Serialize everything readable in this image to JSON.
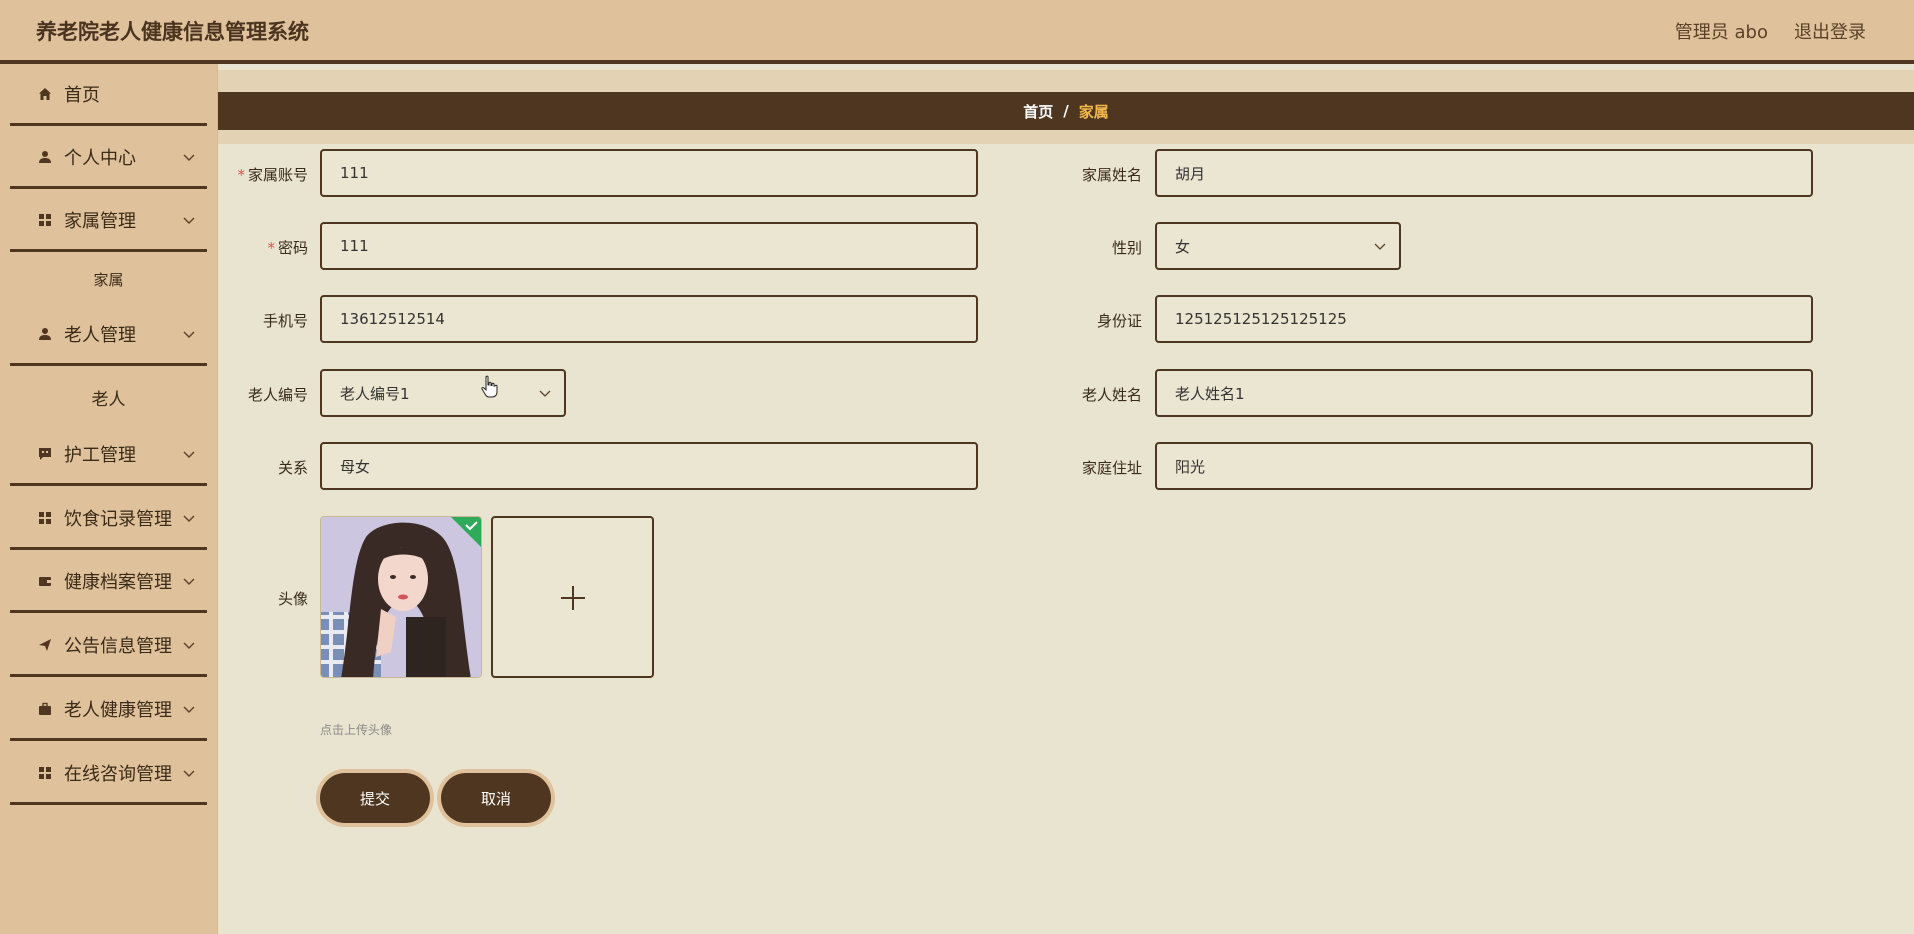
{
  "header": {
    "app_title": "养老院老人健康信息管理系统",
    "user_label": "管理员 abo",
    "logout_label": "退出登录"
  },
  "sidebar": {
    "items": [
      {
        "label": "首页",
        "icon": "home-icon"
      },
      {
        "label": "个人中心",
        "icon": "user-icon"
      },
      {
        "label": "家属管理",
        "icon": "grid-icon"
      },
      {
        "label": "老人管理",
        "icon": "user-icon"
      },
      {
        "label": "护工管理",
        "icon": "chat-icon"
      },
      {
        "label": "饮食记录管理",
        "icon": "grid-icon"
      },
      {
        "label": "健康档案管理",
        "icon": "wallet-icon"
      },
      {
        "label": "公告信息管理",
        "icon": "send-icon"
      },
      {
        "label": "老人健康管理",
        "icon": "briefcase-icon"
      },
      {
        "label": "在线咨询管理",
        "icon": "grid-icon"
      }
    ],
    "subitems": {
      "family": "家属",
      "elder": "老人"
    }
  },
  "breadcrumb": {
    "home": "首页",
    "separator": "/",
    "current": "家属"
  },
  "form": {
    "account": {
      "label": "家属账号",
      "value": "111",
      "required": true
    },
    "name": {
      "label": "家属姓名",
      "value": "胡月"
    },
    "password": {
      "label": "密码",
      "value": "111",
      "required": true
    },
    "gender": {
      "label": "性别",
      "value": "女"
    },
    "phone": {
      "label": "手机号",
      "value": "13612512514"
    },
    "id_card": {
      "label": "身份证",
      "value": "125125125125125125"
    },
    "elder_no": {
      "label": "老人编号",
      "value": "老人编号1"
    },
    "elder_name": {
      "label": "老人姓名",
      "value": "老人姓名1"
    },
    "relation": {
      "label": "关系",
      "value": "母女"
    },
    "address": {
      "label": "家庭住址",
      "value": "阳光"
    },
    "avatar": {
      "label": "头像",
      "hint": "点击上传头像"
    },
    "submit_label": "提交",
    "cancel_label": "取消"
  },
  "colors": {
    "header_bg": "#dfc19b",
    "dark_brown": "#4e3620",
    "page_bg": "#e8e4d0",
    "crumb_current": "#f2b94a",
    "success_badge": "#2eaa5a"
  }
}
